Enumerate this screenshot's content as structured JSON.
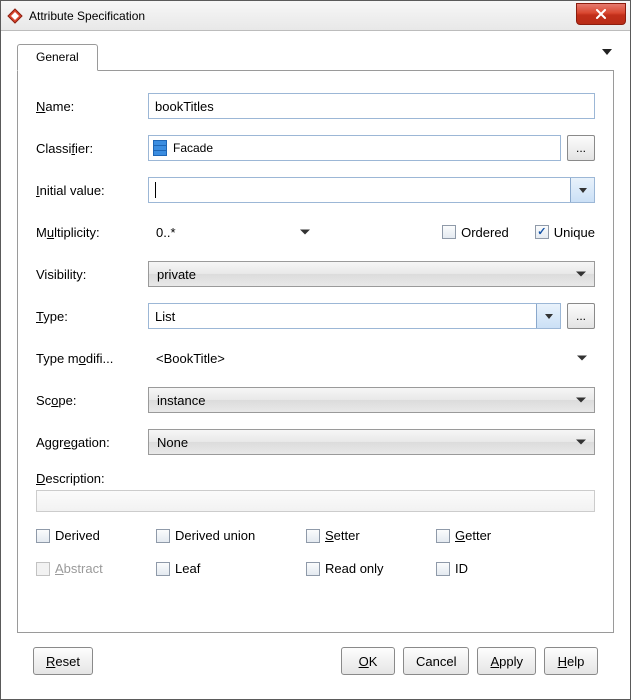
{
  "window": {
    "title": "Attribute Specification"
  },
  "tabs": {
    "general": "General"
  },
  "labels": {
    "name_pre": "",
    "name_u": "N",
    "name_post": "ame:",
    "classifier_pre": "Classi",
    "classifier_u": "f",
    "classifier_post": "ier:",
    "initial_u": "I",
    "initial_post": "nitial value:",
    "mult_pre": "M",
    "mult_u": "u",
    "mult_post": "ltiplicity:",
    "ordered": "Ordered",
    "unique": "Unique",
    "visibility": "Visibility:",
    "type_u": "T",
    "type_post": "ype:",
    "typemod_pre": "Type m",
    "typemod_u": "o",
    "typemod_post": "difi...",
    "scope_pre": "Sc",
    "scope_u": "o",
    "scope_post": "pe:",
    "aggr_pre": "Aggr",
    "aggr_u": "e",
    "aggr_post": "gation:",
    "desc_u": "D",
    "desc_post": "escription:"
  },
  "fields": {
    "name": "bookTitles",
    "classifier": "Facade",
    "initial_value": "",
    "multiplicity": "0..*",
    "ordered": false,
    "unique": true,
    "visibility": "private",
    "type": "List",
    "type_modifier": "<BookTitle>",
    "scope": "instance",
    "aggregation": "None",
    "description": ""
  },
  "flags": {
    "derived": {
      "label": "Derived",
      "checked": false,
      "disabled": false
    },
    "derived_union": {
      "label": "Derived union",
      "checked": false,
      "disabled": false
    },
    "setter_u": "S",
    "setter_post": "etter",
    "setter_checked": false,
    "getter_u": "G",
    "getter_post": "etter",
    "getter_checked": false,
    "abstract_u": "A",
    "abstract_post": "bstract",
    "abstract_disabled": true,
    "leaf": {
      "label": "Leaf",
      "checked": false
    },
    "readonly": {
      "label": "Read only",
      "checked": false
    },
    "id": {
      "label": "ID",
      "checked": false
    }
  },
  "buttons": {
    "reset_u": "R",
    "reset_post": "eset",
    "ok_u": "O",
    "ok_post": "K",
    "cancel": "Cancel",
    "apply_u": "A",
    "apply_post": "pply",
    "help_u": "H",
    "help_post": "elp",
    "ellipsis": "..."
  }
}
